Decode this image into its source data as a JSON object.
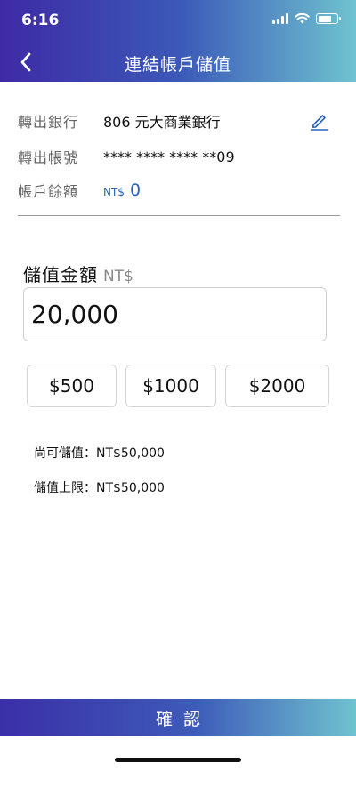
{
  "status_bar": {
    "time": "6:16"
  },
  "header": {
    "title": "連結帳戶儲值"
  },
  "account": {
    "bank_label": "轉出銀行",
    "bank_value": "806 元大商業銀行",
    "account_label": "轉出帳號",
    "account_value": "**** **** **** **09",
    "balance_label": "帳戶餘額",
    "balance_currency": "NT$",
    "balance_value": "0"
  },
  "deposit": {
    "title": "儲值金額",
    "currency": "NT$",
    "amount_value": "20,000"
  },
  "presets": [
    "$500",
    "$1000",
    "$2000"
  ],
  "limits": {
    "remaining": "尚可儲值：NT$50,000",
    "max": "儲值上限：NT$50,000"
  },
  "confirm_label": "確認",
  "colors": {
    "accent_blue": "#2a63b7",
    "gradient_start": "#3f2aa5",
    "gradient_end": "#6fc3cf"
  }
}
